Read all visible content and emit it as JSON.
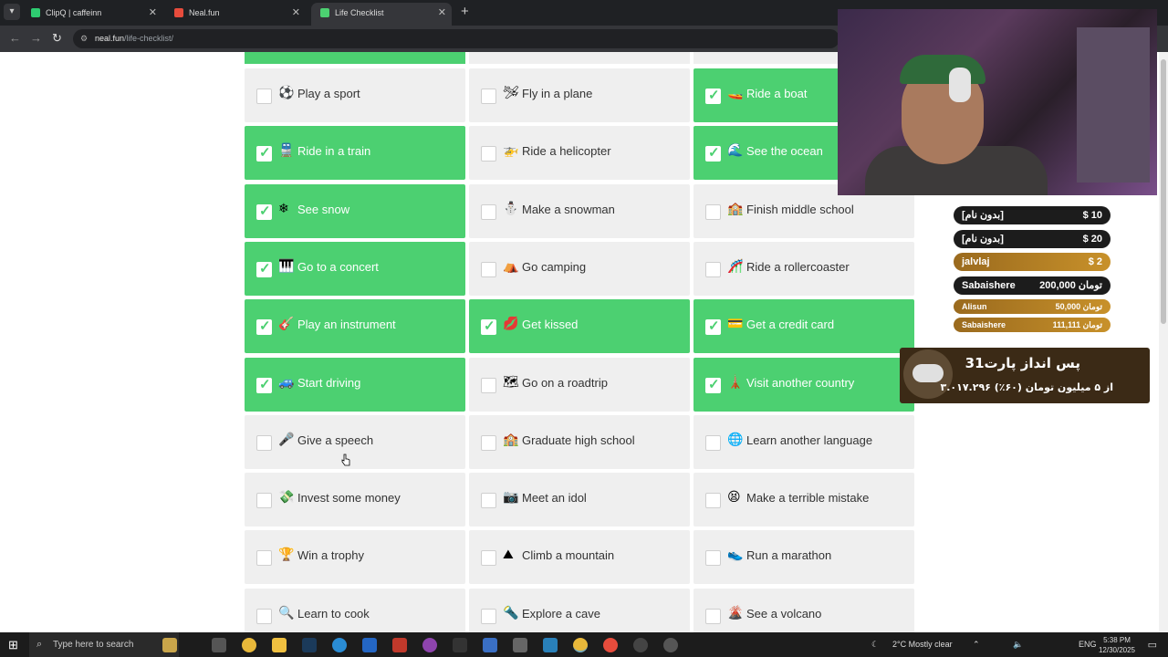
{
  "browser": {
    "tabs": [
      {
        "label": "ClipQ | caffeinn",
        "favicon_color": "#2ecc71",
        "active": false
      },
      {
        "label": "Neal.fun",
        "favicon_color": "#e74c3c",
        "active": false
      },
      {
        "label": "Life Checklist",
        "favicon_color": "#4cd071",
        "active": true
      }
    ],
    "new_tab": "+",
    "url_domain": "neal.fun",
    "url_path": "/life-checklist/"
  },
  "checklist": {
    "columns": [
      [
        {
          "label": "Play a sport",
          "emoji": "⚽",
          "done": false
        },
        {
          "label": "Ride in a train",
          "emoji": "🚆",
          "done": true
        },
        {
          "label": "See snow",
          "emoji": "❄",
          "done": true
        },
        {
          "label": "Go to a concert",
          "emoji": "🎹",
          "done": true
        },
        {
          "label": "Play an instrument",
          "emoji": "🎸",
          "done": true
        },
        {
          "label": "Start driving",
          "emoji": "🚙",
          "done": true
        },
        {
          "label": "Give a speech",
          "emoji": "🎤",
          "done": false
        },
        {
          "label": "Invest some money",
          "emoji": "💸",
          "done": false
        },
        {
          "label": "Win a trophy",
          "emoji": "🏆",
          "done": false
        },
        {
          "label": "Learn to cook",
          "emoji": "🔍",
          "done": false
        }
      ],
      [
        {
          "label": "Fly in a plane",
          "emoji": "🛩",
          "done": false
        },
        {
          "label": "Ride a helicopter",
          "emoji": "🚁",
          "done": false
        },
        {
          "label": "Make a snowman",
          "emoji": "⛄",
          "done": false
        },
        {
          "label": "Go camping",
          "emoji": "⛺",
          "done": false
        },
        {
          "label": "Get kissed",
          "emoji": "💋",
          "done": true
        },
        {
          "label": "Go on a roadtrip",
          "emoji": "🗺",
          "done": false
        },
        {
          "label": "Graduate high school",
          "emoji": "🏫",
          "done": false
        },
        {
          "label": "Meet an idol",
          "emoji": "📷",
          "done": false
        },
        {
          "label": "Climb a mountain",
          "emoji": "⛰",
          "done": false
        },
        {
          "label": "Explore a cave",
          "emoji": "🔦",
          "done": false
        }
      ],
      [
        {
          "label": "Ride a boat",
          "emoji": "🚤",
          "done": true
        },
        {
          "label": "See the ocean",
          "emoji": "🌊",
          "done": true
        },
        {
          "label": "Finish middle school",
          "emoji": "🏫",
          "done": false
        },
        {
          "label": "Ride a rollercoaster",
          "emoji": "🎢",
          "done": false
        },
        {
          "label": "Get a credit card",
          "emoji": "💳",
          "done": true
        },
        {
          "label": "Visit another country",
          "emoji": "🗼",
          "done": true
        },
        {
          "label": "Learn another language",
          "emoji": "🌐",
          "done": false
        },
        {
          "label": "Make a terrible mistake",
          "emoji": "😫",
          "done": false
        },
        {
          "label": "Run a marathon",
          "emoji": "👟",
          "done": false
        },
        {
          "label": "See a volcano",
          "emoji": "🌋",
          "done": false
        }
      ]
    ]
  },
  "donations": [
    {
      "name": "[بدون نام]",
      "amount": "$ 10",
      "style": "dark"
    },
    {
      "name": "[بدون نام]",
      "amount": "$ 20",
      "style": "dark"
    },
    {
      "name": "jalvlaj",
      "amount": "$ 2",
      "style": "gold"
    },
    {
      "name": "Sabaishere",
      "amount": "200,000 تومان",
      "style": "dark"
    },
    {
      "name": "Alisun",
      "amount": "50,000 تومان",
      "style": "gold-small"
    },
    {
      "name": "Sabaishere",
      "amount": "111,111 تومان",
      "style": "gold-small"
    }
  ],
  "goal": {
    "title": "پس انداز پارت31",
    "progress": "۳.۰۱۷.۲۹۶ از ۵ میلیون تومان (۶۰٪)"
  },
  "taskbar": {
    "search_placeholder": "Type here to search",
    "weather": "2°C  Mostly clear",
    "language": "ENG",
    "time": "5:38 PM",
    "date": "12/30/2025"
  }
}
